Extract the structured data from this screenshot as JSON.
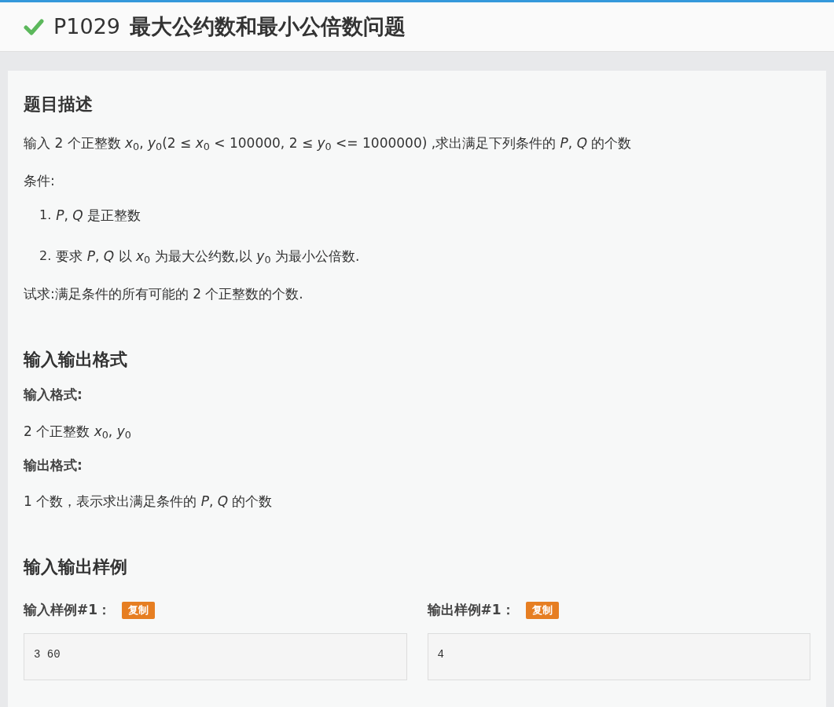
{
  "header": {
    "solved": true,
    "problem_id": "P1029",
    "title": "最大公约数和最小公倍数问题"
  },
  "sections": [
    {
      "heading": "题目描述",
      "blocks": [
        {
          "kind": "paragraph",
          "text": "输入 2 个正整数 *x*$_{0}$, *y*$_{0}$(2 ≤ *x*$_{0}$ < 100000, 2 ≤ *y*$_{0}$ <= 1000000) ,求出满足下列条件的 *P*, *Q* 的个数"
        },
        {
          "kind": "paragraph",
          "text": "条件:"
        },
        {
          "kind": "list",
          "items": [
            {
              "marker": "1.",
              "text": "*P*, *Q* 是正整数"
            },
            {
              "marker": "2.",
              "text": "要求 *P*, *Q* 以 *x*$_{0}$ 为最大公约数,以 *y*$_{0}$ 为最小公倍数."
            }
          ]
        },
        {
          "kind": "paragraph",
          "text": "试求:满足条件的所有可能的 2 个正整数的个数."
        }
      ]
    },
    {
      "heading": "输入输出格式",
      "blocks": [
        {
          "kind": "subheading",
          "text": "输入格式:"
        },
        {
          "kind": "paragraph",
          "text": "2 个正整数 *x*$_{0}$, *y*$_{0}$"
        },
        {
          "kind": "subheading",
          "text": "输出格式:"
        },
        {
          "kind": "paragraph",
          "text": "1 个数，表示求出满足条件的 *P*, *Q* 的个数"
        }
      ]
    },
    {
      "heading": "输入输出样例",
      "samples": [
        {
          "label": "输入样例#1：",
          "copy_button": "复制",
          "value": "3 60"
        },
        {
          "label": "输出样例#1：",
          "copy_button": "复制",
          "value": "4"
        }
      ]
    }
  ]
}
